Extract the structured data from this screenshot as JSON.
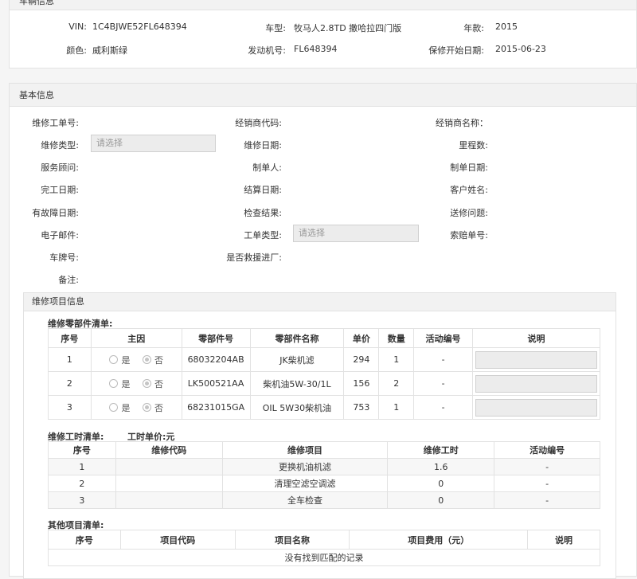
{
  "vehicle": {
    "title": "车辆信息",
    "fields": [
      {
        "label": "VIN:",
        "value": "1C4BJWE52FL648394"
      },
      {
        "label": "车型:",
        "value": "牧马人2.8TD 撒哈拉四门版"
      },
      {
        "label": "年款:",
        "value": "2015"
      },
      {
        "label": "颜色:",
        "value": "威利斯绿"
      },
      {
        "label": "发动机号:",
        "value": "FL648394"
      },
      {
        "label": "保修开始日期:",
        "value": "2015-06-23"
      }
    ]
  },
  "basic": {
    "title": "基本信息",
    "labels": {
      "repair_no": "维修工单号:",
      "dealer_code": "经销商代码:",
      "dealer_name": "经销商名称：",
      "repair_type": "维修类型:",
      "repair_date": "维修日期:",
      "mileage": "里程数:",
      "advisor": "服务顾问:",
      "creator": "制单人:",
      "create_date": "制单日期:",
      "finish_date": "完工日期:",
      "settle_date": "结算日期:",
      "customer": "客户姓名:",
      "fault_date": "有故障日期:",
      "check_result": "检查结果:",
      "repair_issue": "送修问题:",
      "email": "电子邮件:",
      "order_type": "工单类型:",
      "claim_no": "索赔单号:",
      "plate": "车牌号:",
      "rescue": "是否救援进厂:",
      "remark": "备注:"
    },
    "repair_type_placeholder": "请选择",
    "order_type_placeholder": "请选择"
  },
  "items": {
    "title": "维修项目信息",
    "parts": {
      "title": "维修零部件清单:",
      "headers": [
        "序号",
        "主因",
        "零部件号",
        "零部件名称",
        "单价",
        "数量",
        "活动编号",
        "说明"
      ],
      "yes_label": "是",
      "no_label": "否",
      "rows": [
        {
          "no": "1",
          "part_no": "68032204AB",
          "name": "JK柴机滤",
          "price": "294",
          "qty": "1",
          "activity": "-"
        },
        {
          "no": "2",
          "part_no": "LK500521AA",
          "name": "柴机油5W-30/1L",
          "price": "156",
          "qty": "2",
          "activity": "-"
        },
        {
          "no": "3",
          "part_no": "68231015GA",
          "name": "OIL 5W30柴机油",
          "price": "753",
          "qty": "1",
          "activity": "-"
        }
      ]
    },
    "labor": {
      "title": "维修工时清单:",
      "unit_price_label": "工时单价:元",
      "headers": [
        "序号",
        "维修代码",
        "维修项目",
        "维修工时",
        "活动编号"
      ],
      "rows": [
        {
          "no": "1",
          "code": "",
          "item": "更换机油机滤",
          "hours": "1.6",
          "activity": "-"
        },
        {
          "no": "2",
          "code": "",
          "item": "清理空滤空调滤",
          "hours": "0",
          "activity": "-"
        },
        {
          "no": "3",
          "code": "",
          "item": "全车检查",
          "hours": "0",
          "activity": "-"
        }
      ]
    },
    "other": {
      "title": "其他项目清单:",
      "headers": [
        "序号",
        "项目代码",
        "项目名称",
        "项目费用（元）",
        "说明"
      ],
      "empty_text": "没有找到匹配的记录"
    }
  }
}
